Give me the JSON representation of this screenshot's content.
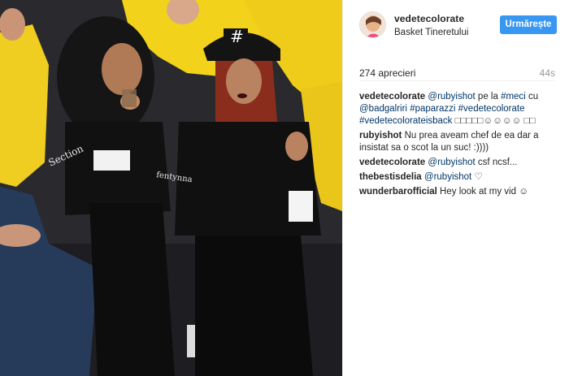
{
  "post": {
    "username": "vedetecolorate",
    "location": "Basket Tineretului",
    "follow_label": "Urmărește",
    "likes": "274 aprecieri",
    "time": "44s"
  },
  "caption": {
    "user": "vedetecolorate",
    "mention1": "@rubyishot",
    "text1": " pe la ",
    "tag1": "#meci",
    "text2": " cu ",
    "mention2": "@badgalriri",
    "tag2": "#paparazzi",
    "tag3": "#vedetecolorate",
    "tag4": "#vedetecolorateisback",
    "emoji": " □□□□□☺☺☺☺ □□"
  },
  "comments": [
    {
      "user": "rubyishot",
      "text": " Nu prea aveam chef de ea dar a insistat sa o scot la un suc! :))))"
    },
    {
      "user": "vedetecolorate",
      "mention": "@rubyishot",
      "text": " csf ncsf..."
    },
    {
      "user": "thebestisdelia",
      "mention": "@rubyishot",
      "text": " ♡"
    },
    {
      "user": "wunderbarofficial",
      "text": " Hey look at my vid ☺"
    }
  ],
  "photo": {
    "cap_text": "#",
    "jacket_text": "fentynna",
    "sweater_text": "Section"
  },
  "colors": {
    "accent": "#3897f0",
    "link": "#003569",
    "crowd_yellow": "#f2d21b"
  }
}
